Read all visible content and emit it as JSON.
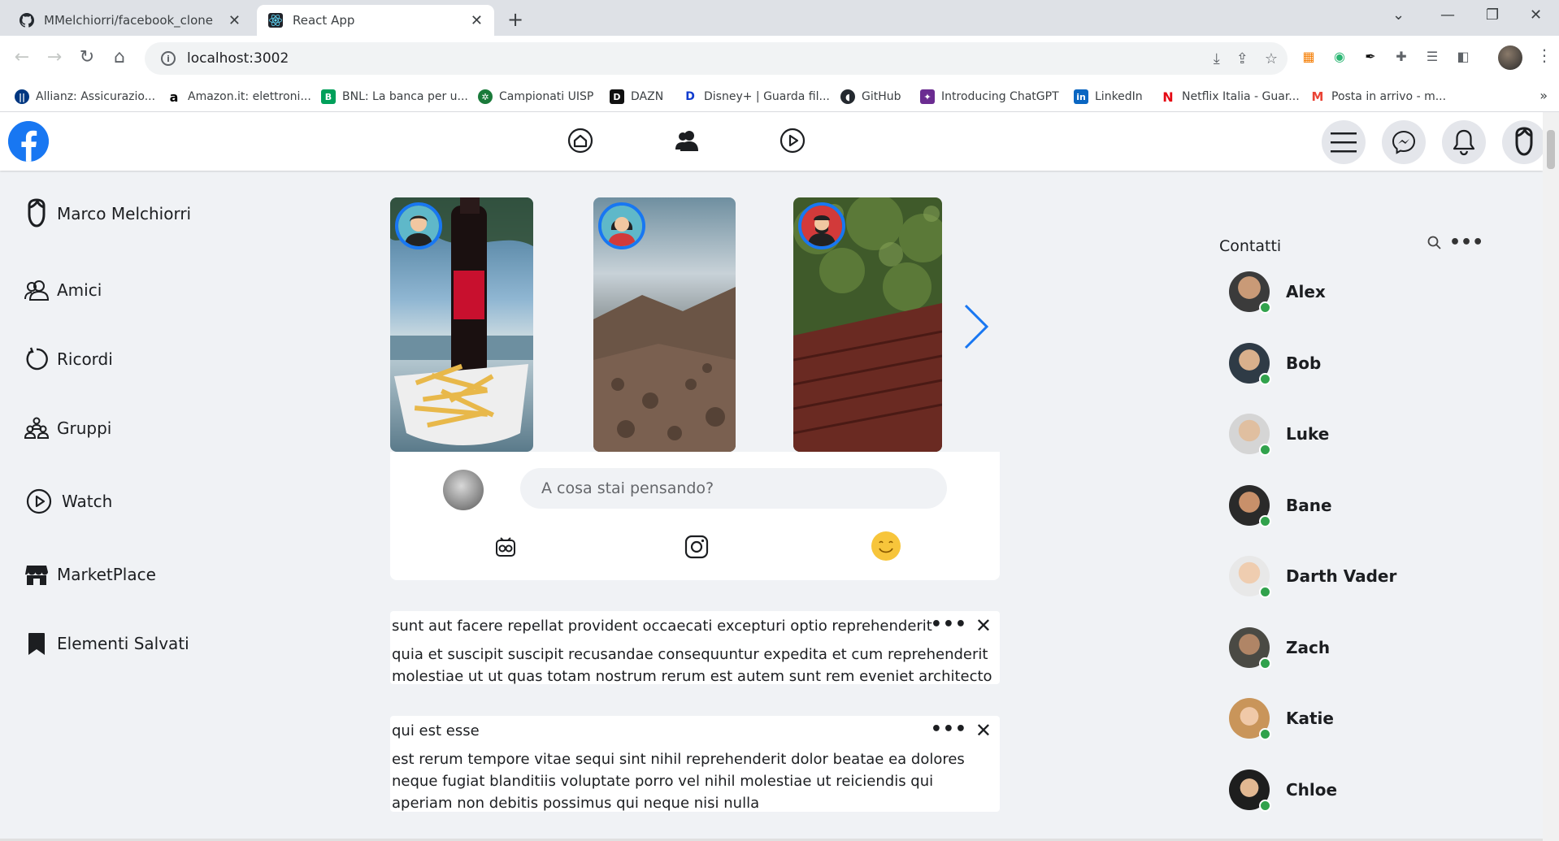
{
  "browser": {
    "tabs": [
      {
        "title": "MMelchiorri/facebook_clone",
        "icon": "github-icon"
      },
      {
        "title": "React App",
        "icon": "react-icon"
      }
    ],
    "url": "localhost:3002",
    "bookmarks": [
      {
        "label": "Allianz: Assicurazio...",
        "icon": "allianz-icon",
        "color": "#003781"
      },
      {
        "label": "Amazon.it: elettroni...",
        "icon": "amazon-icon",
        "color": "#000000"
      },
      {
        "label": "BNL: La banca per u...",
        "icon": "bnl-icon",
        "color": "#00a05a"
      },
      {
        "label": "Campionati UISP",
        "icon": "uisp-icon",
        "color": "#1a7a3a"
      },
      {
        "label": "DAZN",
        "icon": "dazn-icon",
        "color": "#111111"
      },
      {
        "label": "Disney+ | Guarda fil...",
        "icon": "disney-icon",
        "color": "#113ccf"
      },
      {
        "label": "GitHub",
        "icon": "github-icon",
        "color": "#24292f"
      },
      {
        "label": "Introducing ChatGPT",
        "icon": "chatgpt-icon",
        "color": "#6b2c91"
      },
      {
        "label": "LinkedIn",
        "icon": "linkedin-icon",
        "color": "#0a66c2"
      },
      {
        "label": "Netflix Italia - Guar...",
        "icon": "netflix-icon",
        "color": "#e50914"
      },
      {
        "label": "Posta in arrivo - m...",
        "icon": "gmail-icon",
        "color": "#ea4335"
      }
    ]
  },
  "fb": {
    "brand_color": "#1877f2",
    "user_name": "Marco Melchiorri",
    "left_nav": [
      {
        "label": "Marco Melchiorri",
        "icon": "user-outline-icon"
      },
      {
        "label": "Amici",
        "icon": "friends-icon"
      },
      {
        "label": "Ricordi",
        "icon": "memories-icon"
      },
      {
        "label": "Gruppi",
        "icon": "groups-icon"
      },
      {
        "label": "Watch",
        "icon": "watch-icon"
      },
      {
        "label": "MarketPlace",
        "icon": "marketplace-icon"
      },
      {
        "label": "Elementi Salvati",
        "icon": "bookmark-icon"
      }
    ],
    "stories": [
      {
        "photo": "cola-fries-beach"
      },
      {
        "photo": "rocky-hills-clouds"
      },
      {
        "photo": "trees-red-roof"
      }
    ],
    "composer": {
      "placeholder": "A cosa stai pensando?"
    },
    "posts": [
      {
        "title": "sunt aut facere repellat provident occaecati excepturi optio reprehenderit",
        "body": "quia et suscipit suscipit recusandae consequuntur expedita et cum reprehenderit molestiae ut ut quas totam nostrum rerum est autem sunt rem eveniet architecto"
      },
      {
        "title": "qui est esse",
        "body": "est rerum tempore vitae sequi sint nihil reprehenderit dolor beatae ea dolores neque fugiat blanditiis voluptate porro vel nihil molestiae ut reiciendis qui aperiam non debitis possimus qui neque nisi nulla"
      }
    ],
    "contacts_title": "Contatti",
    "contacts": [
      {
        "name": "Alex",
        "online": true
      },
      {
        "name": "Bob",
        "online": true
      },
      {
        "name": "Luke",
        "online": true
      },
      {
        "name": "Bane",
        "online": true
      },
      {
        "name": "Darth Vader",
        "online": true
      },
      {
        "name": "Zach",
        "online": true
      },
      {
        "name": "Katie",
        "online": true
      },
      {
        "name": "Chloe",
        "online": true
      }
    ]
  }
}
